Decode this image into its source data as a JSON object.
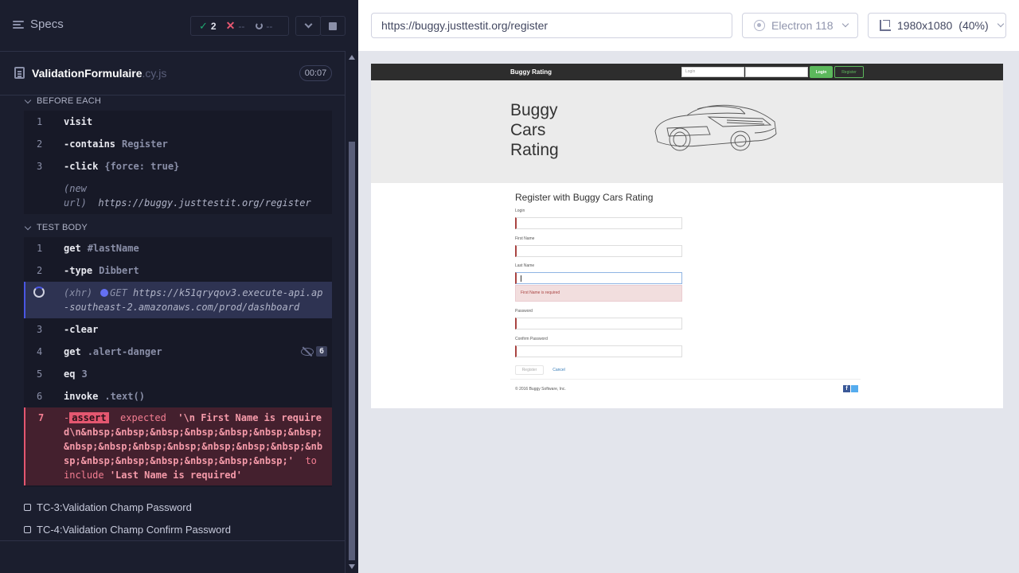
{
  "runner": {
    "specs_label": "Specs",
    "stats": {
      "passed": "2",
      "failed": "--",
      "pending": "--"
    },
    "spec_file": {
      "name": "ValidationFormulaire",
      "ext": ".cy.js",
      "duration": "00:07"
    },
    "before_each": {
      "title": "BEFORE EACH",
      "commands": [
        {
          "num": "1",
          "name": "visit",
          "message": ""
        },
        {
          "num": "2",
          "name": "-contains",
          "message": "Register"
        },
        {
          "num": "3",
          "name": "-click",
          "message": "{force: true}"
        }
      ],
      "new_url": {
        "label_line1": "(new",
        "label_line2": "url)",
        "url": "https://buggy.justtestit.org/register"
      }
    },
    "test_body": {
      "title": "TEST BODY",
      "commands": [
        {
          "num": "1",
          "name": "get",
          "message": "#lastName"
        },
        {
          "num": "2",
          "name": "-type",
          "message": "Dibbert"
        },
        {
          "num": "3",
          "name": "-clear",
          "message": ""
        },
        {
          "num": "4",
          "name": "get",
          "message": ".alert-danger",
          "badge": "6"
        },
        {
          "num": "5",
          "name": "eq",
          "message": "3"
        },
        {
          "num": "6",
          "name": "invoke",
          "message": ".text()"
        }
      ],
      "xhr": {
        "label": "(xhr)",
        "method": "GET",
        "url": "https://k51qryqov3.execute-api.ap-southeast-2.amazonaws.com/prod/dashboard"
      },
      "assert": {
        "num": "7",
        "dash": "-",
        "chip": "assert",
        "kw_expected": "expected",
        "actual": "'\\n First Name is required\\n&nbsp;&nbsp;&nbsp;&nbsp;&nbsp;&nbsp;&nbsp;&nbsp;&nbsp;&nbsp;&nbsp;&nbsp;&nbsp;&nbsp;&nbsp;&nbsp;&nbsp;&nbsp;&nbsp;&nbsp;&nbsp;'",
        "kw_include": "to include",
        "expected": "'Last Name is required'"
      }
    },
    "tests": [
      {
        "label": "TC-3:Validation Champ Password"
      },
      {
        "label": "TC-4:Validation Champ Confirm Password"
      }
    ]
  },
  "browser": {
    "url": "https://buggy.justtestit.org/register",
    "browser_name": "Electron 118",
    "viewport": "1980x1080",
    "zoom": "(40%)"
  },
  "aut": {
    "brand": "Buggy Rating",
    "login_placeholder": "Login",
    "login_button": "Login",
    "register_button": "Register",
    "hero_title": "Buggy Cars Rating",
    "form_title": "Register with Buggy Cars Rating",
    "labels": {
      "login": "Login",
      "first_name": "First Name",
      "last_name": "Last Name",
      "password": "Password",
      "confirm_password": "Confirm Password"
    },
    "alert": "First Name is required",
    "submit": "Register",
    "cancel": "Cancel",
    "footer": "© 2016 Buggy Software, Inc."
  },
  "colors": {
    "runner_bg": "#1b1e2e",
    "pass": "#1fa971",
    "fail": "#e45770",
    "xhr_accent": "#4956e3",
    "aut_success": "#5cb85c",
    "aut_danger": "#a94442"
  }
}
